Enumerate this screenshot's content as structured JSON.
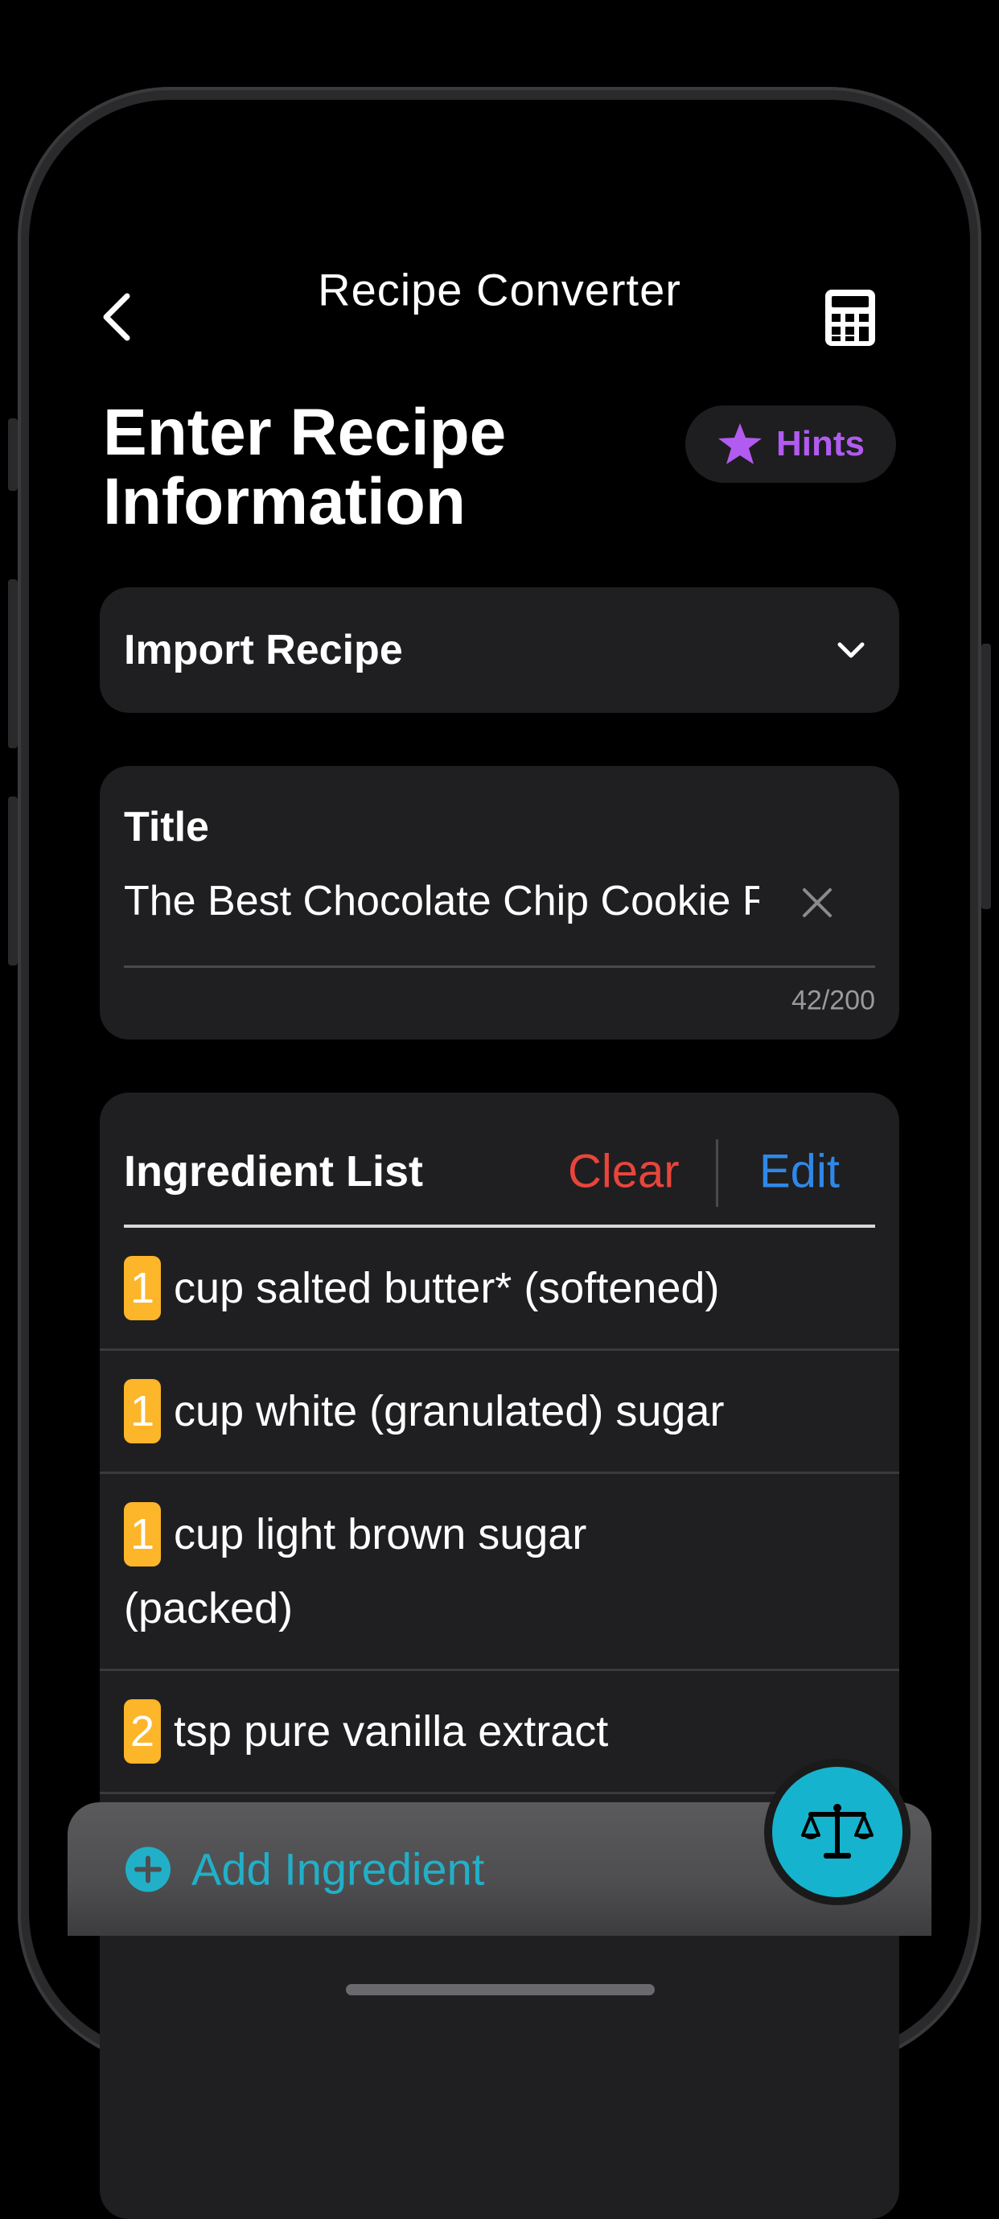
{
  "header": {
    "back_icon": "chevron-left-icon",
    "title": "Recipe Converter",
    "calculator_icon": "calculator-icon"
  },
  "page": {
    "title_line1": "Enter Recipe",
    "title_line2": "Information",
    "hints_label": "Hints",
    "hints_icon": "star-icon",
    "hints_color": "#b25bf0"
  },
  "import": {
    "label": "Import Recipe",
    "icon": "chevron-down-icon"
  },
  "title_field": {
    "label": "Title",
    "value": "The Best Chocolate Chip Cookie Recipe Ever",
    "counter": "42/200",
    "clear_icon": "close-icon"
  },
  "ingredients": {
    "label": "Ingredient List",
    "clear_label": "Clear",
    "edit_label": "Edit",
    "clear_color": "#e8453c",
    "edit_color": "#2f88e8",
    "qty_color": "#fdb52a",
    "items": [
      {
        "qty": "1",
        "text": "cup salted butter* (softened)"
      },
      {
        "qty": "1",
        "text": "cup white (granulated) sugar"
      },
      {
        "qty": "1",
        "text": "cup light brown sugar (packed)"
      },
      {
        "qty": "2",
        "text": "tsp pure vanilla extract"
      }
    ]
  },
  "add_ingredient": {
    "label": "Add Ingredient",
    "icon": "plus-circle-icon",
    "color": "#21b0c8"
  },
  "fab": {
    "icon": "scale-icon",
    "color": "#16b3ce"
  }
}
